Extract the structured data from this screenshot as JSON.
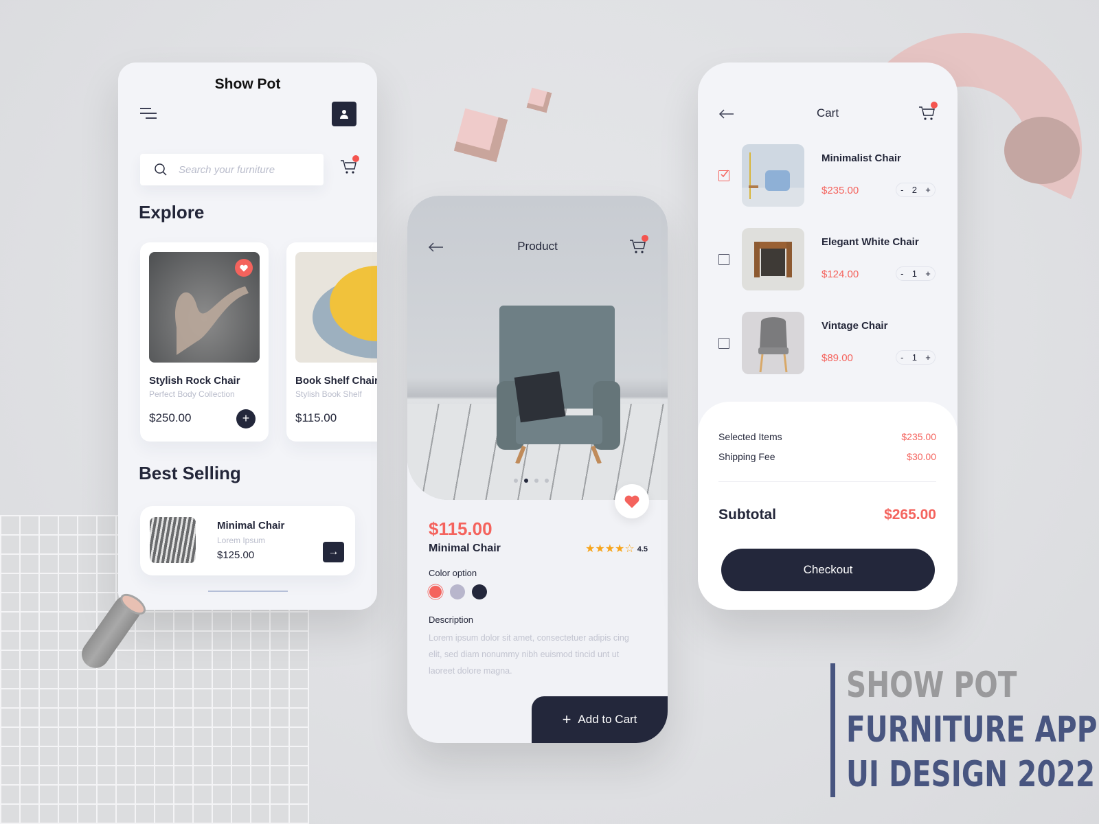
{
  "colors": {
    "primary_dark": "#23273b",
    "accent_red": "#f4635d",
    "muted_text": "#b9bccb",
    "star": "#f7a41a",
    "brand_blue": "#485580",
    "brand_gray": "#9a9a9c"
  },
  "home": {
    "title": "Show Pot",
    "search_placeholder": "Search your furniture",
    "explore_heading": "Explore",
    "explore_items": [
      {
        "name": "Stylish Rock Chair",
        "subtitle": "Perfect Body Collection",
        "price": "$250.00",
        "favorite": true
      },
      {
        "name": "Book Shelf Chair",
        "subtitle": "Stylish Book Shelf",
        "price": "$115.00",
        "favorite": false
      }
    ],
    "best_selling_heading": "Best Selling",
    "best_selling_items": [
      {
        "name": "Minimal Chair",
        "subtitle": "Lorem Ipsum",
        "price": "$125.00"
      }
    ],
    "add_label": "+",
    "go_label": "→"
  },
  "product": {
    "header": "Product",
    "price": "$115.00",
    "name": "Minimal Chair",
    "rating": 4.5,
    "rating_label": "4.5",
    "stars": [
      "★",
      "★",
      "★",
      "★",
      "☆"
    ],
    "image_count": 4,
    "active_image": 2,
    "color_option_label": "Color option",
    "colors": [
      "#f4635d",
      "#b8b6cc",
      "#23273b"
    ],
    "selected_color": 0,
    "description_label": "Description",
    "description": "Lorem ipsum dolor sit amet, consectetuer adipis cing elit, sed diam nonummy nibh euismod tincid unt ut laoreet dolore magna.",
    "add_to_cart_label": "Add to Cart",
    "add_icon": "+"
  },
  "cart": {
    "header": "Cart",
    "items": [
      {
        "name": "Minimalist Chair",
        "price": "$235.00",
        "qty": "2",
        "checked": true
      },
      {
        "name": "Elegant White Chair",
        "price": "$124.00",
        "qty": "1",
        "checked": false
      },
      {
        "name": "Vintage Chair",
        "price": "$89.00",
        "qty": "1",
        "checked": false
      }
    ],
    "qty_minus": "-",
    "qty_plus": "+",
    "selected_items_label": "Selected Items",
    "selected_items_value": "$235.00",
    "shipping_fee_label": "Shipping Fee",
    "shipping_fee_value": "$30.00",
    "subtotal_label": "Subtotal",
    "subtotal_value": "$265.00",
    "checkout_label": "Checkout"
  },
  "branding": {
    "line1": "SHOW POT",
    "line2": "FURNITURE APP",
    "line3": "UI DESIGN 2022"
  }
}
